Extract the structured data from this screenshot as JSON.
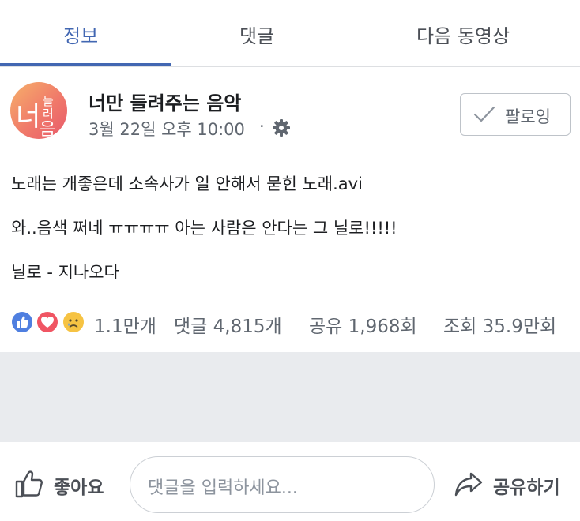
{
  "tabs": [
    {
      "label": "정보",
      "active": true
    },
    {
      "label": "댓글",
      "active": false
    },
    {
      "label": "다음 동영상",
      "active": false
    }
  ],
  "post": {
    "page_name": "너만 들려주는 음악",
    "avatar_text": [
      "너",
      "들",
      "려",
      "음"
    ],
    "time": "3월 22일 오후 10:00",
    "separator": "·",
    "follow_label": "팔로잉",
    "lines": [
      "노래는 개좋은데 소속사가 일 안해서 묻힌 노래.avi",
      "와..음색 쩌네 ㅠㅠㅠㅠ 아는 사람은 안다는 그 닐로!!!!!",
      "닐로 - 지나오다"
    ]
  },
  "stats": {
    "reactions": "1.1만개",
    "comments": "댓글 4,815개",
    "shares": "공유 1,968회",
    "views": "조회 35.9만회"
  },
  "actions": {
    "like_label": "좋아요",
    "comment_placeholder": "댓글을 입력하세요...",
    "share_label": "공유하기"
  },
  "colors": {
    "accent": "#4267b2",
    "like": "#4f7fe0",
    "love": "#f05563",
    "sad": "#f6c343"
  },
  "icons": [
    "gear-icon",
    "check-icon",
    "like-reaction-icon",
    "love-reaction-icon",
    "sad-reaction-icon",
    "thumbs-up-icon",
    "share-arrow-icon"
  ]
}
